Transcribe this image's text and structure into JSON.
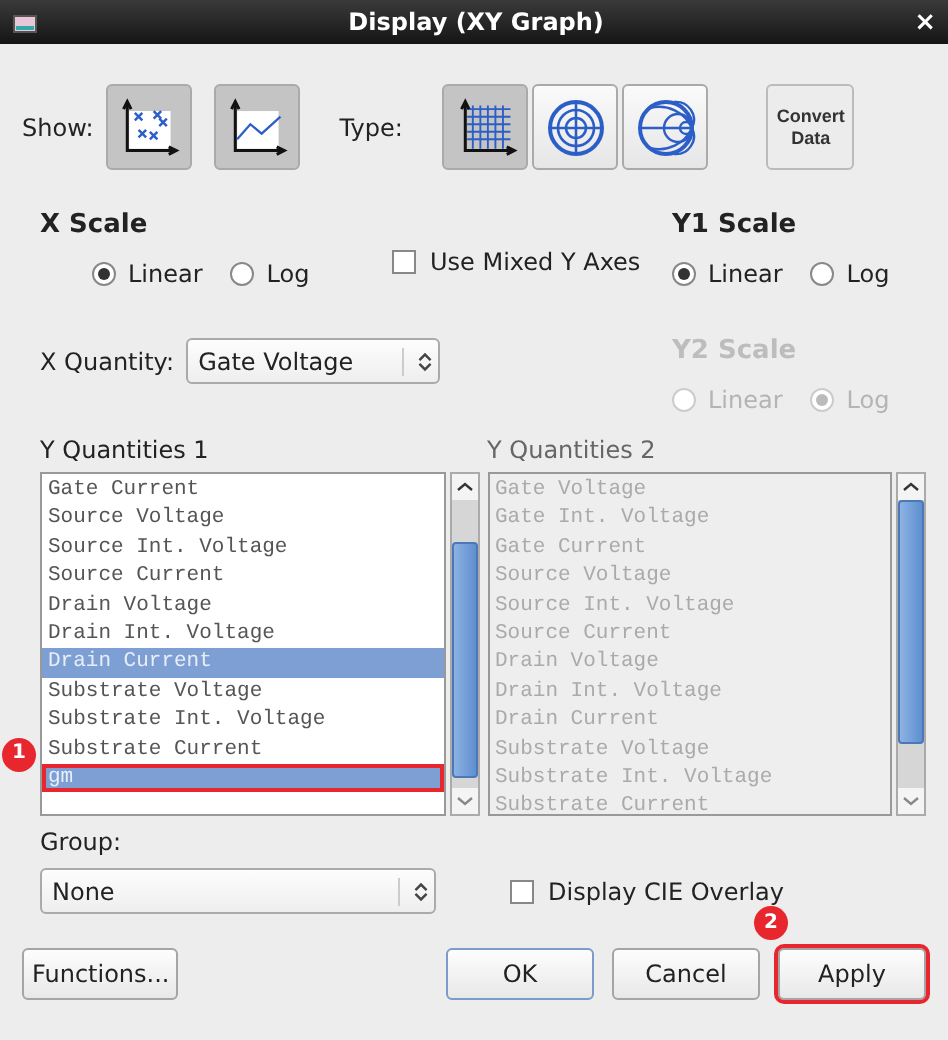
{
  "window": {
    "title": "Display (XY Graph)",
    "close": "×"
  },
  "show": {
    "label": "Show:",
    "buttons": [
      {
        "kind": "scatter",
        "selected": true
      },
      {
        "kind": "line",
        "selected": true
      }
    ]
  },
  "type": {
    "label": "Type:",
    "buttons": [
      {
        "kind": "cartesian",
        "selected": true
      },
      {
        "kind": "polar",
        "selected": false
      },
      {
        "kind": "smith",
        "selected": false
      }
    ]
  },
  "convert_button": "Convert Data",
  "x_scale": {
    "title": "X Scale",
    "disabled": false,
    "options": [
      {
        "label": "Linear",
        "selected": true
      },
      {
        "label": "Log",
        "selected": false
      }
    ]
  },
  "mixed_axes": {
    "label": "Use Mixed Y Axes",
    "checked": false
  },
  "y1_scale": {
    "title": "Y1 Scale",
    "disabled": false,
    "options": [
      {
        "label": "Linear",
        "selected": true
      },
      {
        "label": "Log",
        "selected": false
      }
    ]
  },
  "y2_scale": {
    "title": "Y2 Scale",
    "disabled": true,
    "options": [
      {
        "label": "Linear",
        "selected": false
      },
      {
        "label": "Log",
        "selected": true
      }
    ]
  },
  "x_quantity": {
    "label": "X Quantity:",
    "value": "Gate Voltage"
  },
  "y_quantities_1": {
    "label": "Y Quantities 1",
    "disabled": false,
    "items": [
      {
        "label": "Gate Current",
        "selected": false
      },
      {
        "label": "Source Voltage",
        "selected": false
      },
      {
        "label": "Source Int. Voltage",
        "selected": false
      },
      {
        "label": "Source Current",
        "selected": false
      },
      {
        "label": "Drain Voltage",
        "selected": false
      },
      {
        "label": "Drain Int. Voltage",
        "selected": false
      },
      {
        "label": "Drain Current",
        "selected": true
      },
      {
        "label": "Substrate Voltage",
        "selected": false
      },
      {
        "label": "Substrate Int. Voltage",
        "selected": false
      },
      {
        "label": "Substrate Current",
        "selected": false
      },
      {
        "label": "gm",
        "selected": true,
        "badge": "1"
      }
    ]
  },
  "y_quantities_2": {
    "label": "Y Quantities 2",
    "disabled": true,
    "items": [
      {
        "label": "Gate Voltage",
        "selected": false
      },
      {
        "label": "Gate Int. Voltage",
        "selected": false
      },
      {
        "label": "Gate Current",
        "selected": false
      },
      {
        "label": "Source Voltage",
        "selected": false
      },
      {
        "label": "Source Int. Voltage",
        "selected": false
      },
      {
        "label": "Source Current",
        "selected": false
      },
      {
        "label": "Drain Voltage",
        "selected": false
      },
      {
        "label": "Drain Int. Voltage",
        "selected": false
      },
      {
        "label": "Drain Current",
        "selected": false
      },
      {
        "label": "Substrate Voltage",
        "selected": false
      },
      {
        "label": "Substrate Int. Voltage",
        "selected": false
      },
      {
        "label": "Substrate Current",
        "selected": false
      }
    ]
  },
  "group": {
    "label": "Group:",
    "value": "None"
  },
  "cie_overlay": {
    "label": "Display CIE Overlay",
    "checked": false
  },
  "buttons": [
    {
      "kind": "functions",
      "label": "Functions...",
      "default": false
    },
    {
      "kind": "ok",
      "label": "OK",
      "default": true
    },
    {
      "kind": "cancel",
      "label": "Cancel",
      "default": false
    },
    {
      "kind": "apply",
      "label": "Apply",
      "default": false,
      "badge": "2"
    }
  ]
}
